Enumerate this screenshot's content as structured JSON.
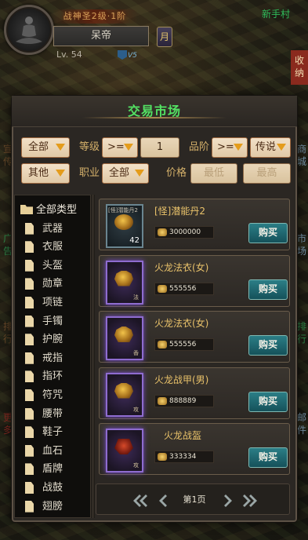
{
  "hud": {
    "title_badge": "战神圣2级·1阶",
    "player_name": "呆帝",
    "level_text": "Lv.  54",
    "vip_text": "V5",
    "bag_button": "月",
    "location": "新手村",
    "collapse_tab": "收纳"
  },
  "side_labels": {
    "left": [
      "宣传",
      "广告",
      "排行",
      "更多"
    ],
    "right": [
      "商城",
      "市场",
      "排行",
      "邮件"
    ]
  },
  "market": {
    "title": "交易市场",
    "filters": {
      "type_all": "全部",
      "level_label": "等级",
      "level_op": ">=",
      "level_value": "1",
      "quality_label": "品阶",
      "quality_op": ">=",
      "quality_value": "传说",
      "other": "其他",
      "job_label": "职业",
      "job_value": "全部",
      "price_label": "价格",
      "price_min_placeholder": "最低",
      "price_max_placeholder": "最高"
    },
    "categories": [
      "全部类型",
      "武器",
      "衣服",
      "头盔",
      "勋章",
      "项链",
      "手镯",
      "护腕",
      "戒指",
      "指环",
      "符咒",
      "腰带",
      "鞋子",
      "血石",
      "盾牌",
      "战鼓",
      "翅膀"
    ],
    "items": [
      {
        "name": "[怪]潜能丹2",
        "price": "3000000",
        "slot_tag": "[怪]潜能丹2",
        "count": "42",
        "mark": "",
        "art": "orb",
        "buy": "购买"
      },
      {
        "name": "火龙法衣(女)",
        "price": "555556",
        "slot_tag": "",
        "count": "",
        "mark": "法",
        "art": "armor",
        "buy": "购买"
      },
      {
        "name": "火龙法衣(女)",
        "price": "555556",
        "slot_tag": "",
        "count": "",
        "mark": "香",
        "art": "armor",
        "buy": "购买"
      },
      {
        "name": "火龙战甲(男)",
        "price": "888889",
        "slot_tag": "",
        "count": "",
        "mark": "攻",
        "art": "armor",
        "buy": "购买"
      },
      {
        "name": "火龙战盔",
        "price": "333334",
        "slot_tag": "",
        "count": "",
        "mark": "攻",
        "art": "helm",
        "buy": "购买"
      }
    ],
    "pager": {
      "label": "第1页"
    }
  },
  "colors": {
    "title_green": "#53e163",
    "dropdown_arrow": "#e49c1c",
    "buy_teal": "#2b7e86",
    "rare_purple": "#8e6ccf"
  }
}
